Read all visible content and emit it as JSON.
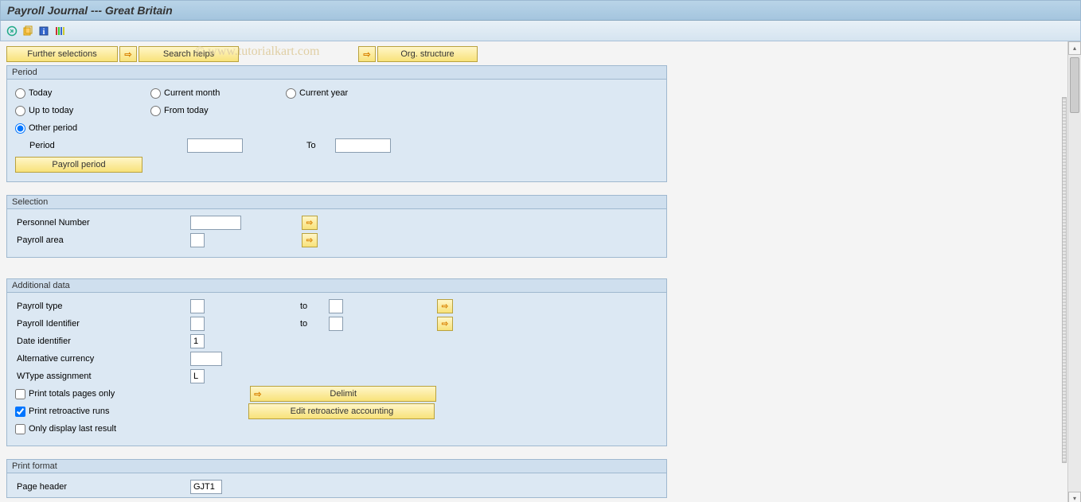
{
  "title": "Payroll Journal --- Great Britain",
  "watermark": "© www.tutorialkart.com",
  "buttons": {
    "further_selections": "Further selections",
    "search_helps": "Search helps",
    "org_structure": "Org. structure",
    "payroll_period": "Payroll period",
    "delimit": "Delimit",
    "edit_retro": "Edit retroactive accounting"
  },
  "group_period": {
    "title": "Period",
    "today": "Today",
    "current_month": "Current month",
    "current_year": "Current year",
    "up_to_today": "Up to today",
    "from_today": "From today",
    "other_period": "Other period",
    "period_lbl": "Period",
    "to_lbl": "To"
  },
  "group_selection": {
    "title": "Selection",
    "personnel_number": "Personnel Number",
    "payroll_area": "Payroll area"
  },
  "group_additional": {
    "title": "Additional data",
    "payroll_type": "Payroll type",
    "payroll_identifier": "Payroll Identifier",
    "to": "to",
    "date_identifier": "Date identifier",
    "date_identifier_val": "1",
    "alt_currency": "Alternative currency",
    "wtype": "WType assignment",
    "wtype_val": "L",
    "print_totals": "Print totals pages only",
    "print_retro": "Print retroactive runs",
    "only_display": "Only display last result"
  },
  "group_print": {
    "title": "Print format",
    "page_header": "Page header",
    "page_header_val": "GJT1"
  }
}
